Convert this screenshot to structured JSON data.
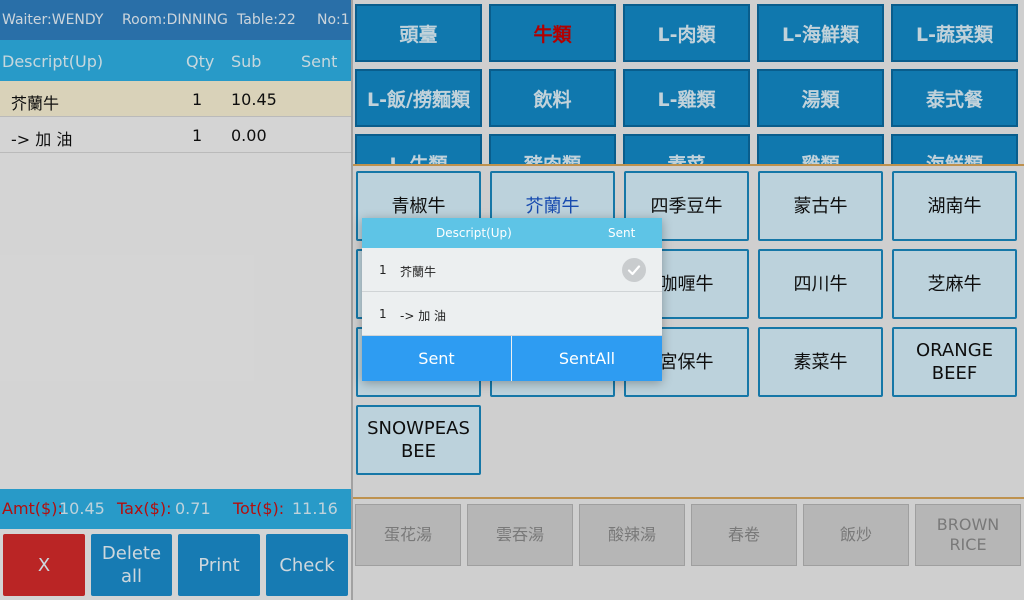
{
  "header": {
    "waiter": "Waiter:WENDY",
    "room": "Room:DINNING",
    "table": "Table:22",
    "no": "No:1"
  },
  "order_columns": {
    "descript": "Descript(Up)",
    "qty": "Qty",
    "sub": "Sub",
    "sent": "Sent"
  },
  "order_items": [
    {
      "name": "芥蘭牛",
      "qty": "1",
      "sub": "10.45"
    },
    {
      "name": "-> 加 油",
      "qty": "1",
      "sub": "0.00"
    }
  ],
  "totals": {
    "amt_label": "Amt($):",
    "amt": "10.45",
    "tax_label": "Tax($):",
    "tax": "0.71",
    "tot_label": "Tot($):",
    "tot": "11.16"
  },
  "actions": {
    "x": "X",
    "delete_all": "Delete all",
    "print": "Print",
    "check": "Check"
  },
  "categories": [
    "頭臺",
    "牛類",
    "L-肉類",
    "L-海鮮類",
    "L-蔬菜類",
    "L-飯/撈麵類",
    "飲料",
    "L-雞類",
    "湯類",
    "泰式餐",
    "L-牛類",
    "豬肉類",
    "素菜",
    "雞類",
    "海鮮類"
  ],
  "items": [
    "青椒牛",
    "芥蘭牛",
    "四季豆牛",
    "蒙古牛",
    "湖南牛",
    "",
    "咖喱牛",
    "四川牛",
    "芝麻牛",
    "",
    "宮保牛",
    "素菜牛",
    "ORANGE BEEF",
    "SNOWPEAS BEE"
  ],
  "soups": [
    "蛋花湯",
    "雲吞湯",
    "酸辣湯",
    "春卷",
    "飯炒",
    "BROWN RICE"
  ],
  "dialog": {
    "header_descript": "Descript(Up)",
    "header_sent": "Sent",
    "rows": [
      {
        "qty": "1",
        "name": "芥蘭牛"
      },
      {
        "qty": "1",
        "name": "-> 加 油"
      }
    ],
    "sent_button": "Sent",
    "sent_all_button": "SentAll"
  },
  "colors": {
    "topbar": "#2f7fc0",
    "accent_blue": "#2eb0e4",
    "category_button": "#1389c7",
    "active_category_text": "#cc0000",
    "x_button": "#d42b2b",
    "action_button": "#1b8ccc",
    "dialog_button": "#2e9cf2"
  }
}
